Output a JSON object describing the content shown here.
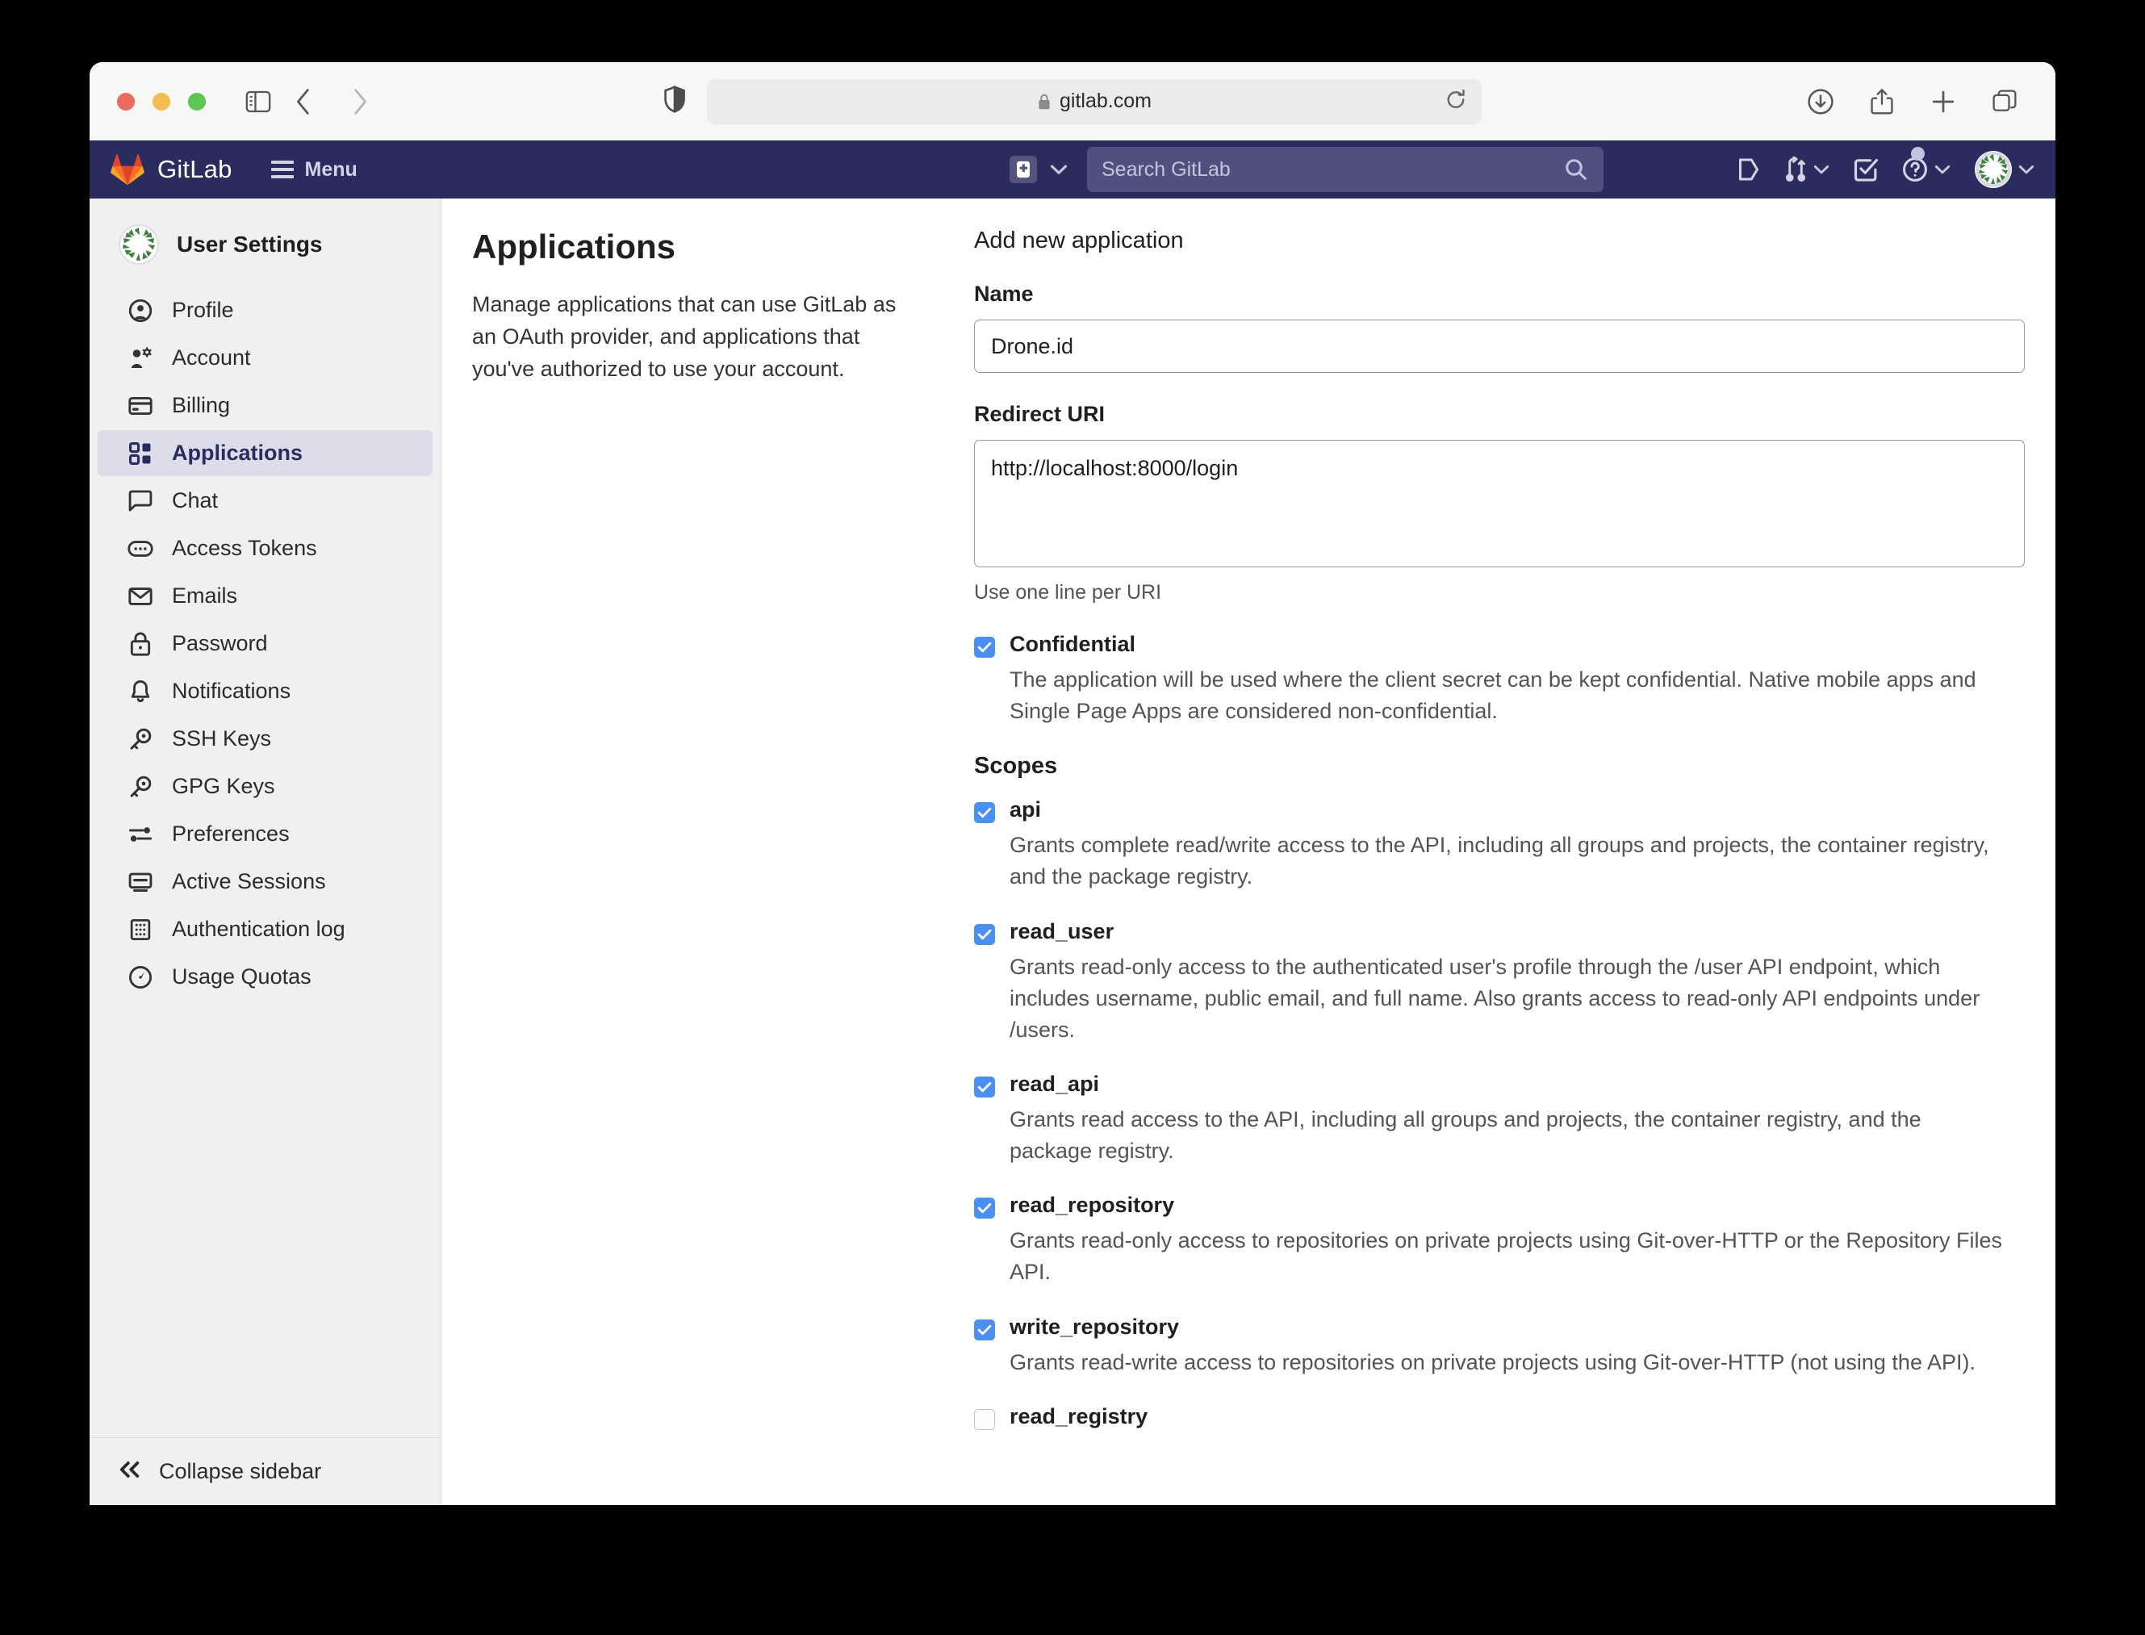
{
  "browser": {
    "url": "gitlab.com",
    "traffic_lights": [
      "close",
      "minimize",
      "zoom"
    ],
    "toolbar_icons": [
      "sidebar-icon",
      "back-icon",
      "forward-icon",
      "shield-icon",
      "lock-icon",
      "reload-icon",
      "downloads-icon",
      "share-icon",
      "new-tab-icon",
      "tab-overview-icon"
    ]
  },
  "navbar": {
    "brand": "GitLab",
    "menu_label": "Menu",
    "search_placeholder": "Search GitLab",
    "icons": [
      "plus-icon",
      "chevron-down-icon",
      "search-icon",
      "issues-icon",
      "merge-requests-icon",
      "todos-icon",
      "help-icon",
      "avatar"
    ],
    "brand_bg": "#2b2c5e",
    "search_bg": "#4f5080"
  },
  "sidebar": {
    "title": "User Settings",
    "items": [
      {
        "label": "Profile",
        "icon": "profile-icon",
        "active": false
      },
      {
        "label": "Account",
        "icon": "account-icon",
        "active": false
      },
      {
        "label": "Billing",
        "icon": "billing-icon",
        "active": false
      },
      {
        "label": "Applications",
        "icon": "applications-icon",
        "active": true
      },
      {
        "label": "Chat",
        "icon": "chat-icon",
        "active": false
      },
      {
        "label": "Access Tokens",
        "icon": "access-tokens-icon",
        "active": false
      },
      {
        "label": "Emails",
        "icon": "emails-icon",
        "active": false
      },
      {
        "label": "Password",
        "icon": "password-icon",
        "active": false
      },
      {
        "label": "Notifications",
        "icon": "notifications-icon",
        "active": false
      },
      {
        "label": "SSH Keys",
        "icon": "ssh-keys-icon",
        "active": false
      },
      {
        "label": "GPG Keys",
        "icon": "gpg-keys-icon",
        "active": false
      },
      {
        "label": "Preferences",
        "icon": "preferences-icon",
        "active": false
      },
      {
        "label": "Active Sessions",
        "icon": "active-sessions-icon",
        "active": false
      },
      {
        "label": "Authentication log",
        "icon": "authentication-log-icon",
        "active": false
      },
      {
        "label": "Usage Quotas",
        "icon": "usage-quotas-icon",
        "active": false
      }
    ],
    "collapse_label": "Collapse sidebar",
    "active_color": "#2b2c5e",
    "active_bg": "#dcdcea"
  },
  "page": {
    "title": "Applications",
    "description": "Manage applications that can use GitLab as an OAuth provider, and applications that you've authorized to use your account."
  },
  "form": {
    "heading": "Add new application",
    "name_label": "Name",
    "name_value": "Drone.id",
    "name_placeholder": "",
    "redirect_label": "Redirect URI",
    "redirect_value": "http://localhost:8000/login",
    "redirect_placeholder": "",
    "redirect_hint": "Use one line per URI",
    "confidential": {
      "label": "Confidential",
      "checked": true,
      "description": "The application will be used where the client secret can be kept confidential. Native mobile apps and Single Page Apps are considered non-confidential."
    },
    "scopes_heading": "Scopes",
    "scopes": [
      {
        "name": "api",
        "checked": true,
        "description": "Grants complete read/write access to the API, including all groups and projects, the container registry, and the package registry."
      },
      {
        "name": "read_user",
        "checked": true,
        "description": "Grants read-only access to the authenticated user's profile through the /user API endpoint, which includes username, public email, and full name. Also grants access to read-only API endpoints under /users."
      },
      {
        "name": "read_api",
        "checked": true,
        "description": "Grants read access to the API, including all groups and projects, the container registry, and the package registry."
      },
      {
        "name": "read_repository",
        "checked": true,
        "description": "Grants read-only access to repositories on private projects using Git-over-HTTP or the Repository Files API."
      },
      {
        "name": "write_repository",
        "checked": true,
        "description": "Grants read-write access to repositories on private projects using Git-over-HTTP (not using the API)."
      },
      {
        "name": "read_registry",
        "checked": false,
        "description": ""
      }
    ],
    "checkbox_checked_color": "#4a90f2"
  }
}
